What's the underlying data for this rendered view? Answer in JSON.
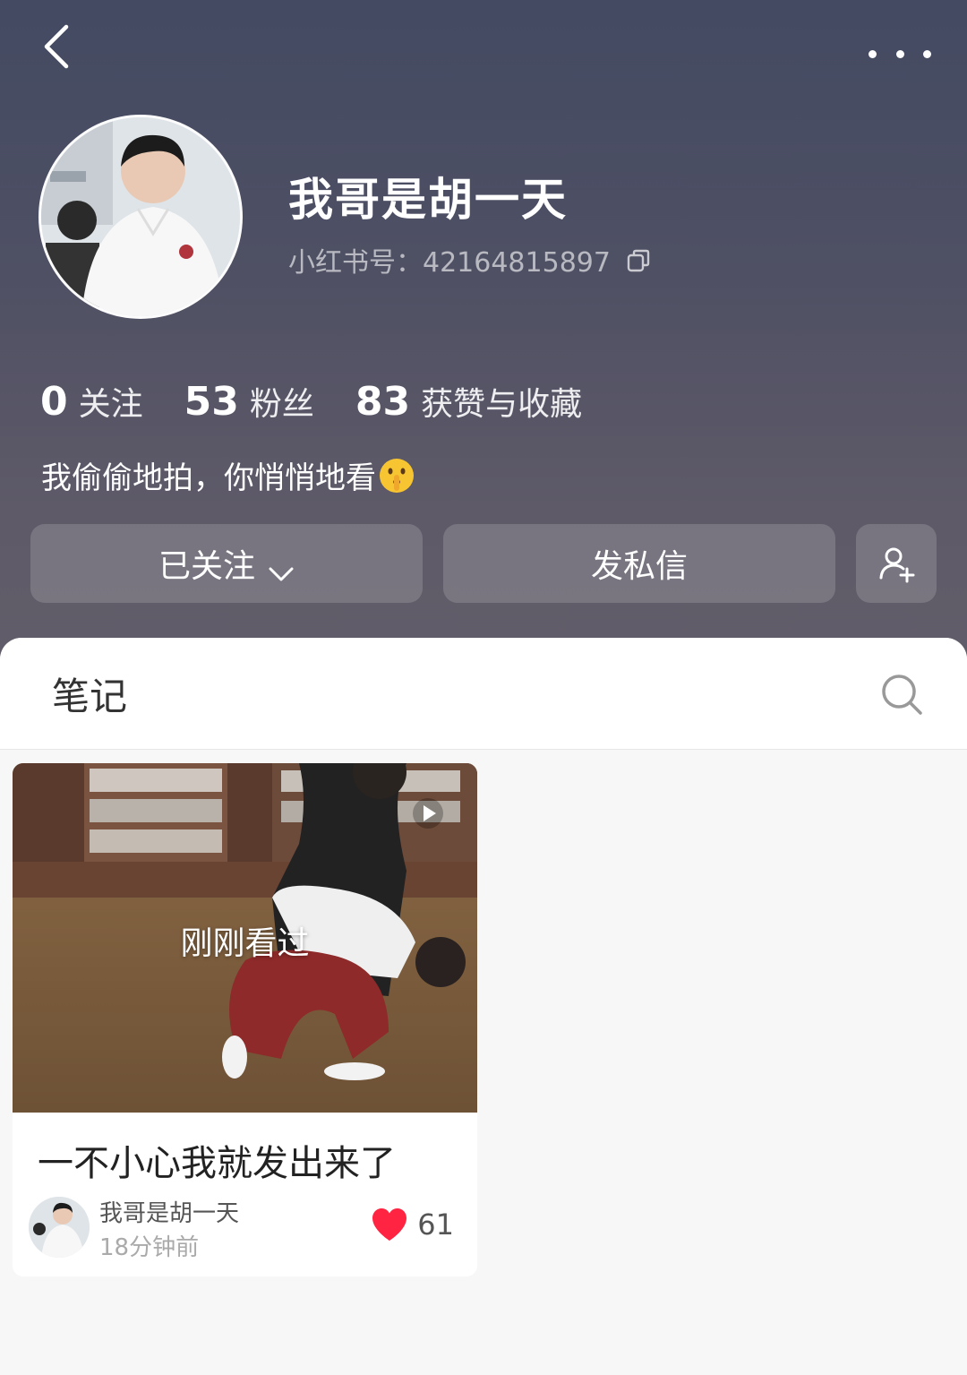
{
  "profile": {
    "nickname": "我哥是胡一天",
    "red_id": "小红书号：42164815897",
    "stats": [
      {
        "value": "0",
        "label": "关注"
      },
      {
        "value": "53",
        "label": "粉丝"
      },
      {
        "value": "83",
        "label": "获赞与收藏"
      }
    ],
    "bio": "我偷偷地拍，你悄悄地看"
  },
  "actions": {
    "follow_label": "已关注",
    "message_label": "发私信"
  },
  "tabs": {
    "notes_label": "笔记"
  },
  "notes": [
    {
      "overlay": "刚刚看过",
      "title": "一不小心我就发出来了",
      "author": "我哥是胡一天",
      "time": "18分钟前",
      "likes": "61"
    }
  ],
  "colors": {
    "header_top": "#434a62",
    "header_bottom": "#625d69",
    "like_red": "#ff2442"
  },
  "icons": [
    "back-arrow-icon",
    "more-icon",
    "copy-icon",
    "shush-emoji-icon",
    "chevron-down-icon",
    "add-friend-icon",
    "search-icon",
    "play-icon",
    "heart-icon"
  ]
}
